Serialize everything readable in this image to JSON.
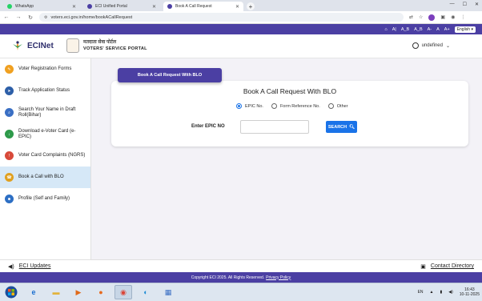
{
  "browser": {
    "tabs": [
      {
        "label": "WhatsApp",
        "color": "#25d366"
      },
      {
        "label": "ECI Unified Portal",
        "color": "#4b3fa3"
      },
      {
        "label": "Book A Call Request",
        "color": "#4b3fa3"
      }
    ],
    "url": "voters.eci.gov.in/home/bookACallRequest"
  },
  "topbar": {
    "font_small": "A-",
    "font_normal": "A",
    "font_large": "A+",
    "language": "English",
    "text_sizes": [
      "A|",
      "A_B",
      "A_B"
    ]
  },
  "header": {
    "logo_text": "ECINet",
    "portal_hindi": "मतदाता सेवा पोर्टल",
    "portal_english": "VOTERS' SERVICE PORTAL",
    "user_name": "undefined"
  },
  "sidebar": {
    "items": [
      {
        "label": "Voter Registration Forms",
        "icon": "form-icon",
        "color": "#f0a020"
      },
      {
        "label": "Track Application Status",
        "icon": "track-icon",
        "color": "#2d5fa8"
      },
      {
        "label": "Search Your Name in Draft Roll(Bihar)",
        "icon": "search-icon",
        "color": "#3a6fc4"
      },
      {
        "label": "Download e-Voter Card (e-EPIC)",
        "icon": "download-icon",
        "color": "#2e9a4a"
      },
      {
        "label": "Voter Card Complaints (NGRS)",
        "icon": "complaint-icon",
        "color": "#d84a3a"
      },
      {
        "label": "Book a Call with BLO",
        "icon": "phone-icon",
        "color": "#e0a020"
      },
      {
        "label": "Profile (Self and Family)",
        "icon": "profile-icon",
        "color": "#2d6fc4"
      }
    ],
    "active_index": 5
  },
  "main": {
    "tab_label": "Book A Call Request With BLO",
    "card_title": "Book A Call Request With BLO",
    "radio_options": [
      "EPIC No.",
      "Form Reference No.",
      "Other"
    ],
    "radio_selected": 0,
    "field_label": "Enter EPIC NO",
    "field_value": "",
    "search_label": "SEARCH"
  },
  "updates": {
    "left_label": "ECI Updates",
    "right_label": "Contact Directory"
  },
  "footer": {
    "copyright": "Copyright ECI 2025. All Rights Reserved.",
    "privacy": "Privacy Policy"
  },
  "taskbar": {
    "lang": "EN",
    "time": "16:43",
    "date": "10-11-2025"
  }
}
